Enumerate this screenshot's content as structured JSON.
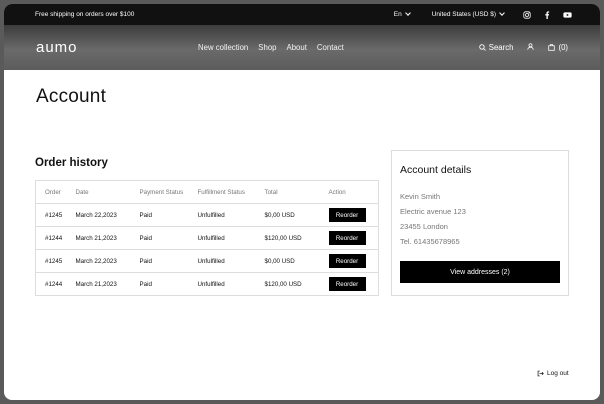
{
  "announcement": {
    "text": "Free shipping on orders over $100",
    "language": "En",
    "currency": "United States (USD $)"
  },
  "header": {
    "logo": "aumo",
    "nav": [
      "New collection",
      "Shop",
      "About",
      "Contact"
    ],
    "search_label": "Search",
    "cart_count": "(0)"
  },
  "page": {
    "title": "Account",
    "order_history_title": "Order history"
  },
  "orders": {
    "columns": [
      "Order",
      "Date",
      "Payment Status",
      "Fulfillment Status",
      "Total",
      "Action"
    ],
    "rows": [
      {
        "order": "#1245",
        "date": "March 22,2023",
        "payment": "Paid",
        "fulfillment": "Unfulfilled",
        "total": "$0,00 USD",
        "action": "Reorder"
      },
      {
        "order": "#1244",
        "date": "March 21,2023",
        "payment": "Paid",
        "fulfillment": "Unfulfilled",
        "total": "$120,00 USD",
        "action": "Reorder"
      },
      {
        "order": "#1245",
        "date": "March 22,2023",
        "payment": "Paid",
        "fulfillment": "Unfulfilled",
        "total": "$0,00 USD",
        "action": "Reorder"
      },
      {
        "order": "#1244",
        "date": "March 21,2023",
        "payment": "Paid",
        "fulfillment": "Unfulfilled",
        "total": "$120,00 USD",
        "action": "Reorder"
      }
    ]
  },
  "account": {
    "title": "Account details",
    "name": "Kevin Smith",
    "street": "Electric avenue 123",
    "city": "23455 London",
    "phone": "Tel. 61435678965",
    "addresses_button": "View addresses (2)"
  },
  "logout_label": "Log out",
  "icons": {
    "instagram": "instagram-icon",
    "facebook": "facebook-icon",
    "youtube": "youtube-icon",
    "search": "search-icon",
    "user": "user-icon",
    "cart": "cart-icon",
    "logout": "logout-icon"
  }
}
